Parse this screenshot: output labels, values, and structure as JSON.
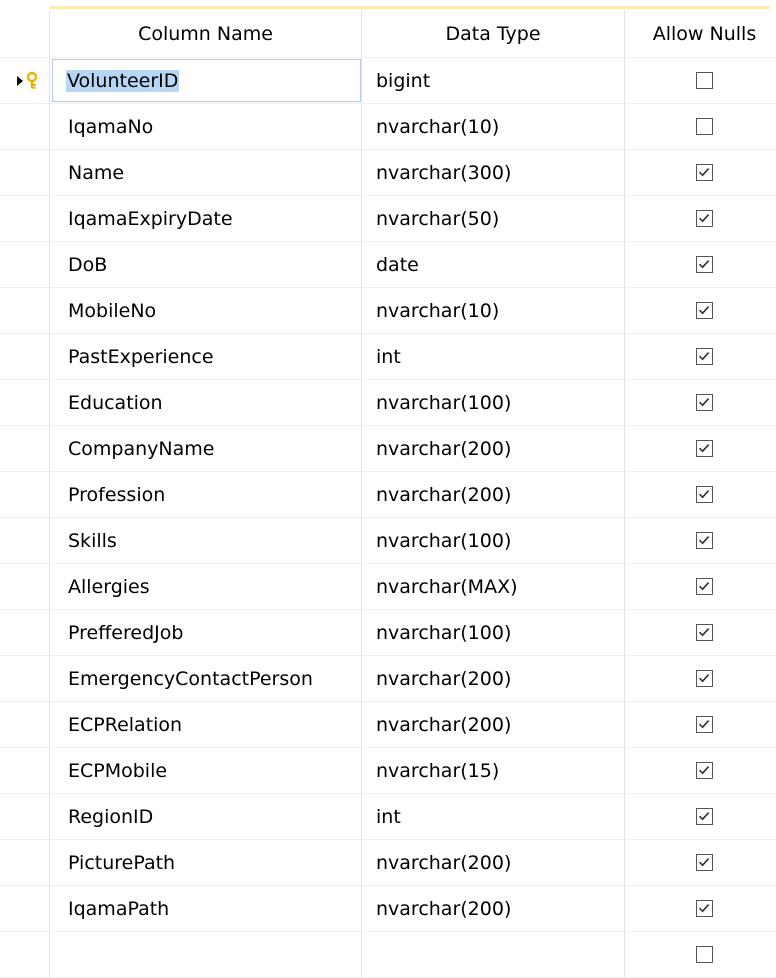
{
  "header": {
    "column_name": "Column Name",
    "data_type": "Data Type",
    "allow_nulls": "Allow Nulls"
  },
  "rows": [
    {
      "name": "VolunteerID",
      "type": "bigint",
      "allow_nulls": false,
      "primary_key": true,
      "current": true
    },
    {
      "name": "IqamaNo",
      "type": "nvarchar(10)",
      "allow_nulls": false
    },
    {
      "name": "Name",
      "type": "nvarchar(300)",
      "allow_nulls": true
    },
    {
      "name": "IqamaExpiryDate",
      "type": "nvarchar(50)",
      "allow_nulls": true
    },
    {
      "name": "DoB",
      "type": "date",
      "allow_nulls": true
    },
    {
      "name": "MobileNo",
      "type": "nvarchar(10)",
      "allow_nulls": true
    },
    {
      "name": "PastExperience",
      "type": "int",
      "allow_nulls": true
    },
    {
      "name": "Education",
      "type": "nvarchar(100)",
      "allow_nulls": true
    },
    {
      "name": "CompanyName",
      "type": "nvarchar(200)",
      "allow_nulls": true
    },
    {
      "name": "Profession",
      "type": "nvarchar(200)",
      "allow_nulls": true
    },
    {
      "name": "Skills",
      "type": "nvarchar(100)",
      "allow_nulls": true
    },
    {
      "name": "Allergies",
      "type": "nvarchar(MAX)",
      "allow_nulls": true
    },
    {
      "name": "PrefferedJob",
      "type": "nvarchar(100)",
      "allow_nulls": true
    },
    {
      "name": "EmergencyContactPerson",
      "type": "nvarchar(200)",
      "allow_nulls": true
    },
    {
      "name": "ECPRelation",
      "type": "nvarchar(200)",
      "allow_nulls": true
    },
    {
      "name": "ECPMobile",
      "type": "nvarchar(15)",
      "allow_nulls": true
    },
    {
      "name": "RegionID",
      "type": "int",
      "allow_nulls": true
    },
    {
      "name": "PicturePath",
      "type": "nvarchar(200)",
      "allow_nulls": true
    },
    {
      "name": "IqamaPath",
      "type": "nvarchar(200)",
      "allow_nulls": true
    },
    {
      "name": "",
      "type": "",
      "allow_nulls": false
    }
  ],
  "icons": {
    "current_row": "row-pointer-icon",
    "primary_key": "key-icon",
    "checked": "checkmark-icon"
  },
  "colors": {
    "selection": "#b7d6f4",
    "edit_border": "#b6cce8",
    "key_gold": "#e8b400",
    "top_accent": "#fde9b4"
  }
}
